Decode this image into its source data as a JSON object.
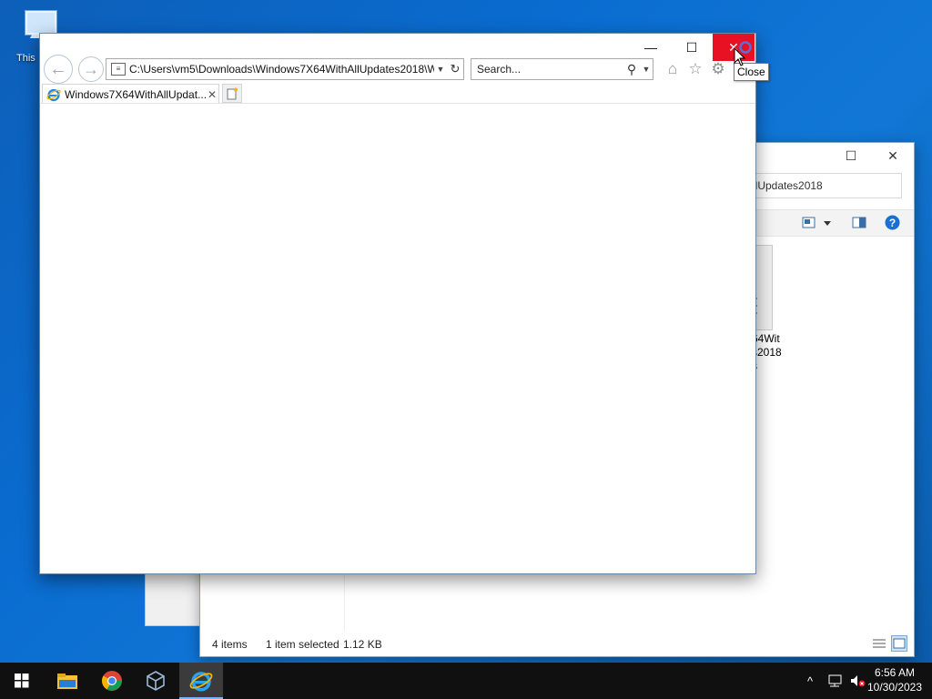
{
  "desktop": {
    "icon_label": "This"
  },
  "explorer": {
    "address_fragment": "llUpdates2018",
    "file_name_lines": [
      "64Wit",
      "s2018",
      "s"
    ],
    "status_items": "4 items",
    "status_selected": "1 item selected",
    "status_size": "1.12 KB",
    "minimize_glyph": "—",
    "maximize_glyph": "☐",
    "close_glyph": "✕"
  },
  "ie": {
    "address_url": "C:\\Users\\vm5\\Downloads\\Windows7X64WithAllUpdates2018\\W",
    "search_placeholder": "Search...",
    "tab_title": "Windows7X64WithAllUpdat...",
    "tab_close": "✕",
    "minimize_glyph": "—",
    "maximize_glyph": "☐",
    "close_glyph": "✕",
    "back_glyph": "←",
    "forward_glyph": "→",
    "refresh_glyph": "↻",
    "search_glyph": "⚲",
    "dropdown_glyph": "▼",
    "home_glyph": "⌂",
    "favorites_glyph": "☆",
    "settings_glyph": "⚙",
    "accent_close_color": "#e81123"
  },
  "tooltip": {
    "text": "Close"
  },
  "taskbar": {
    "time": "6:56 AM",
    "date": "10/30/2023",
    "tray_chevron": "^",
    "icons": [
      "start-icon",
      "file-explorer-icon",
      "chrome-icon",
      "virtualbox-icon",
      "internet-explorer-icon"
    ]
  }
}
